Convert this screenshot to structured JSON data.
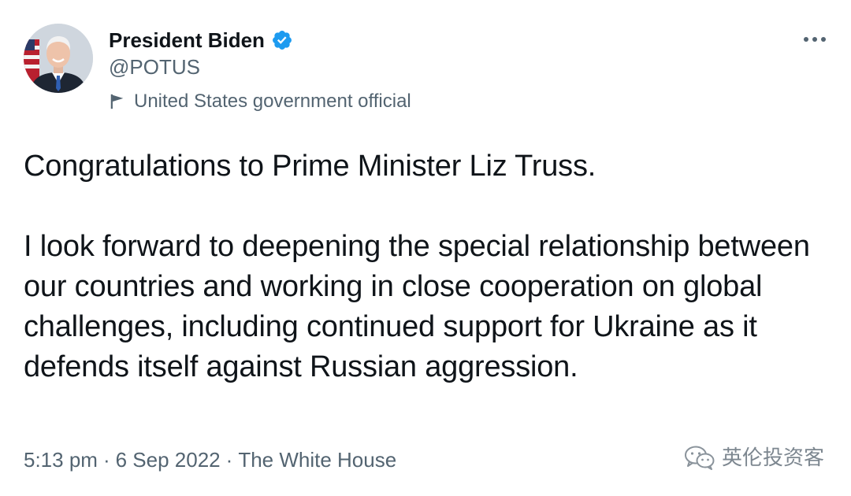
{
  "author": {
    "display_name": "President Biden",
    "handle": "@POTUS",
    "label": "United States government official",
    "verified": true,
    "verified_color": "#1d9bf0",
    "avatar_icon": "avatar-photo",
    "label_icon": "flag-icon"
  },
  "tweet": {
    "paragraphs": [
      "Congratulations to Prime Minister Liz Truss.",
      "I look forward to deepening the special relationship between our countries and working in close cooperation on global challenges, including continued support for Ukraine as it defends itself against Russian aggression."
    ],
    "time": "5:13 pm",
    "date": "6 Sep 2022",
    "source": "The White House",
    "separator": "·"
  },
  "menu": {
    "more_icon": "more-horizontal-icon"
  },
  "watermark": {
    "text": "英伦投资客",
    "icon": "wechat-icon"
  },
  "colors": {
    "text_primary": "#0f1419",
    "text_secondary": "#536471",
    "background": "#ffffff",
    "accent": "#1d9bf0"
  }
}
